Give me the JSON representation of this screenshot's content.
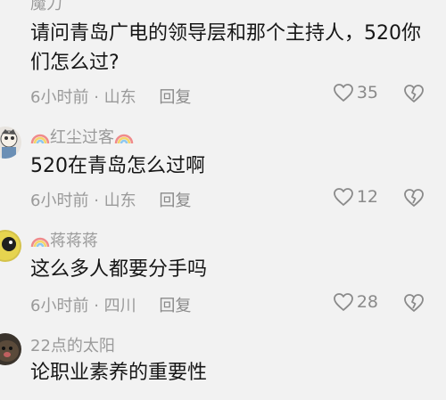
{
  "comments": [
    {
      "username": "魔力",
      "content": "请问青岛广电的领导层和那个主持人，520你们怎么过?",
      "time": "6小时前",
      "location": "山东",
      "reply": "回复",
      "likes": "35",
      "rainbow": false
    },
    {
      "username": "红尘过客",
      "content": "520在青岛怎么过啊",
      "time": "6小时前",
      "location": "山东",
      "reply": "回复",
      "likes": "12",
      "rainbow": true
    },
    {
      "username": "蒋蒋蒋",
      "content": "这么多人都要分手吗",
      "time": "6小时前",
      "location": "四川",
      "reply": "回复",
      "likes": "28",
      "rainbow": true
    },
    {
      "username": "22点的太阳",
      "content": "论职业素养的重要性",
      "time": "",
      "location": "",
      "reply": "",
      "likes": "",
      "rainbow": false
    }
  ],
  "icons": {
    "like": "heart-outline-icon",
    "dislike": "broken-heart-icon",
    "name_decoration": "rainbow-icon"
  },
  "colors": {
    "background": "#f2f2f2",
    "text": "#161616",
    "secondary": "#9a9a9a"
  }
}
